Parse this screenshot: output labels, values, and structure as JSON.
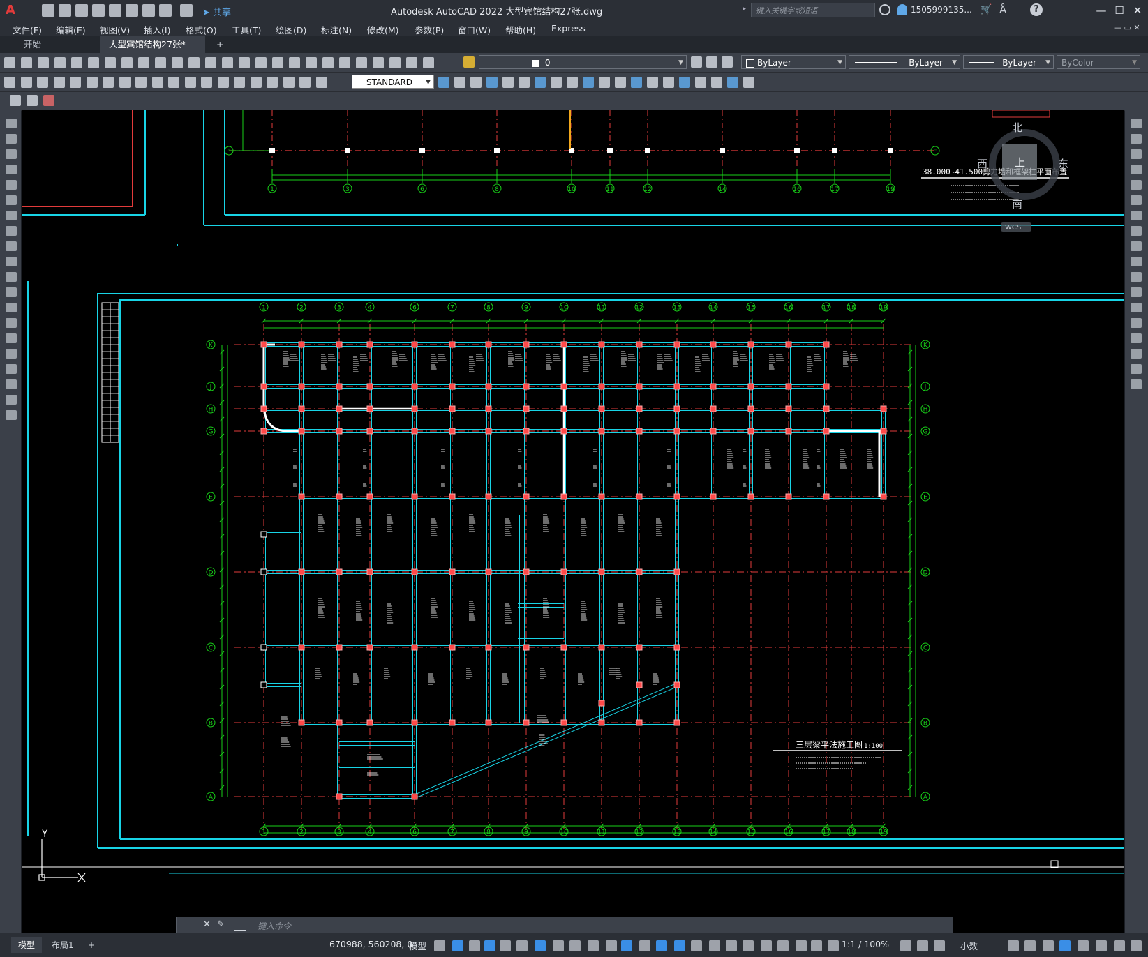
{
  "app": {
    "title": "Autodesk AutoCAD 2022    大型宾馆结构27张.dwg",
    "share_label": "共享",
    "search_placeholder": "键入关键字或短语",
    "user": "1505999135...",
    "window_controls": [
      "minimize-icon",
      "maximize-icon",
      "close-icon"
    ]
  },
  "menu": [
    "文件(F)",
    "编辑(E)",
    "视图(V)",
    "插入(I)",
    "格式(O)",
    "工具(T)",
    "绘图(D)",
    "标注(N)",
    "修改(M)",
    "参数(P)",
    "窗口(W)",
    "帮助(H)",
    "Express"
  ],
  "tabs": {
    "start": "开始",
    "active": "大型宾馆结构27张*",
    "close": "×",
    "add": "+"
  },
  "toolbar": {
    "layer_value": "0",
    "color_value": "ByLayer",
    "linetype_value": "ByLayer",
    "lineweight_value": "ByLayer",
    "plotstyle_value": "ByColor",
    "dimstyle_value": "STANDARD"
  },
  "viewcube": {
    "north": "北",
    "south": "南",
    "east": "东",
    "west": "西",
    "top": "上",
    "wcs": "WCS"
  },
  "drawing": {
    "upper_title": "38.000~41.500剪力墙和框架柱平面布置",
    "main_title": "三层梁平法施工图",
    "main_scale": "1:100",
    "grid_numbers": [
      "1",
      "2",
      "3",
      "4",
      "6",
      "7",
      "8",
      "9",
      "10",
      "11",
      "12",
      "13",
      "14",
      "15",
      "16",
      "17",
      "18",
      "19"
    ],
    "upper_grid_numbers": [
      "1",
      "3",
      "6",
      "8",
      "10",
      "11",
      "12",
      "14",
      "16",
      "17",
      "19"
    ],
    "grid_letters": [
      "K",
      "J",
      "H",
      "G",
      "E",
      "D",
      "C",
      "B",
      "A"
    ],
    "upper_axis_letter": "E",
    "ucs_y": "Y"
  },
  "command": {
    "placeholder": "键入命令"
  },
  "status": {
    "model_tab": "模型",
    "layout_tab": "布局1",
    "add_tab": "+",
    "coords": "670988, 560208, 0",
    "space": "模型",
    "scale": "1:1 / 100%",
    "units": "小数"
  }
}
